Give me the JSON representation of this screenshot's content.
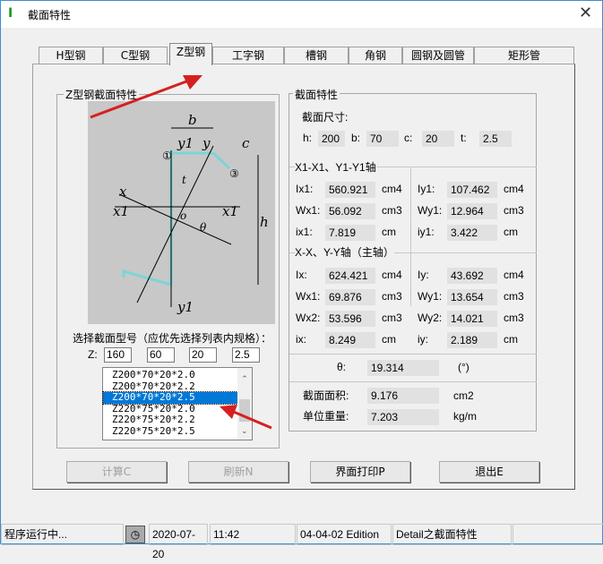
{
  "window": {
    "title": "截面特性",
    "app_icon": "I",
    "close": "✕"
  },
  "tabs": [
    {
      "label": "H型钢"
    },
    {
      "label": "C型钢"
    },
    {
      "label": "Z型钢",
      "active": true
    },
    {
      "label": "工字钢"
    },
    {
      "label": "槽钢"
    },
    {
      "label": "角钢"
    },
    {
      "label": "圆钢及圆管"
    },
    {
      "label": "矩形管"
    }
  ],
  "left_group": {
    "title": "Z型钢截面特性",
    "diagram_labels": {
      "b": "b",
      "c": "c",
      "h": "h",
      "t": "t",
      "x": "x",
      "x1": "x1",
      "y": "y",
      "y1": "y1",
      "o": "o",
      "theta": "θ",
      "p1": "①",
      "p3": "③"
    },
    "select_label": "选择截面型号（应优先选择列表内规格）：",
    "z_label": "Z:",
    "inputs": [
      "160",
      "60",
      "20",
      "2.5"
    ],
    "list": [
      "Z200*70*20*2.0",
      "Z200*70*20*2.2",
      "Z200*70*20*2.5",
      "Z220*75*20*2.0",
      "Z220*75*20*2.2",
      "Z220*75*20*2.5"
    ],
    "selected_index": 2
  },
  "right_group": {
    "title": "截面特性",
    "dims_label": "截面尺寸:",
    "dims": [
      {
        "k": "h:",
        "v": "200"
      },
      {
        "k": "b:",
        "v": "70"
      },
      {
        "k": "c:",
        "v": "20"
      },
      {
        "k": "t:",
        "v": "2.5"
      }
    ],
    "axis1_title": "X1-X1、Y1-Y1轴",
    "axis1": [
      [
        {
          "k": "Ix1:",
          "v": "560.921",
          "u": "cm4"
        },
        {
          "k": "Iy1:",
          "v": "107.462",
          "u": "cm4"
        }
      ],
      [
        {
          "k": "Wx1:",
          "v": "56.092",
          "u": "cm3"
        },
        {
          "k": "Wy1:",
          "v": "12.964",
          "u": "cm3"
        }
      ],
      [
        {
          "k": "ix1:",
          "v": "7.819",
          "u": "cm"
        },
        {
          "k": "iy1:",
          "v": "3.422",
          "u": "cm"
        }
      ]
    ],
    "axis2_title": "X-X、Y-Y轴（主轴）",
    "axis2": [
      [
        {
          "k": "Ix:",
          "v": "624.421",
          "u": "cm4"
        },
        {
          "k": "Iy:",
          "v": "43.692",
          "u": "cm4"
        }
      ],
      [
        {
          "k": "Wx1:",
          "v": "69.876",
          "u": "cm3"
        },
        {
          "k": "Wy1:",
          "v": "13.654",
          "u": "cm3"
        }
      ],
      [
        {
          "k": "Wx2:",
          "v": "53.596",
          "u": "cm3"
        },
        {
          "k": "Wy2:",
          "v": "14.021",
          "u": "cm3"
        }
      ],
      [
        {
          "k": "ix:",
          "v": "8.249",
          "u": "cm"
        },
        {
          "k": "iy:",
          "v": "2.189",
          "u": "cm"
        }
      ]
    ],
    "theta": {
      "k": "θ:",
      "v": "19.314",
      "u": "(°)"
    },
    "area": {
      "k": "截面面积:",
      "v": "9.176",
      "u": "cm2"
    },
    "weight": {
      "k": "单位重量:",
      "v": "7.203",
      "u": "kg/m"
    }
  },
  "buttons": [
    {
      "label": "计算C",
      "enabled": false
    },
    {
      "label": "刷新N",
      "enabled": false
    },
    {
      "label": "界面打印P",
      "enabled": true
    },
    {
      "label": "退出E",
      "enabled": true
    }
  ],
  "status": [
    "程序运行中...",
    "2020-07-20",
    "11:42",
    "04-04-02 Edition",
    "Detail之截面特性",
    ""
  ],
  "colors": {
    "arrow": "#d62020",
    "selection": "#0078d7",
    "diagram_bg": "#c8c8c8",
    "section": "#7fd4d4"
  }
}
